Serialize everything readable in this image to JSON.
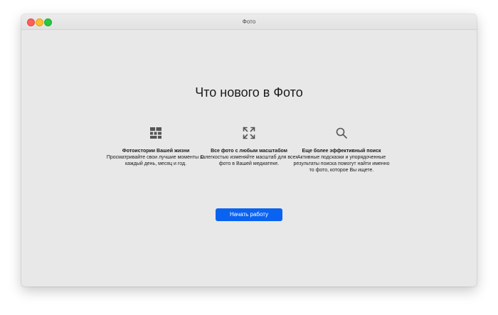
{
  "window": {
    "title": "Фото"
  },
  "main": {
    "headline": "Что нового в Фото",
    "features": [
      {
        "icon": "grid-icon",
        "title": "Фотоистории Вашей жизни",
        "description": "Просматривайте свои лучшие моменты за каждый день, месяц и год."
      },
      {
        "icon": "expand-arrows-icon",
        "title": "Все фото с любым масштабом",
        "description": "С легкостью изменяйте масштаб для всех фото в Вашей медиатеке."
      },
      {
        "icon": "search-icon",
        "title": "Еще более эффективный поиск",
        "description": "Активные подсказки и упорядоченные результаты поиска помогут найти именно то фото, которое Вы ищете."
      }
    ],
    "start_button": "Начать работу"
  },
  "colors": {
    "accent": "#0a63f0",
    "window_bg": "#e8e8e8",
    "icon": "#555555"
  }
}
